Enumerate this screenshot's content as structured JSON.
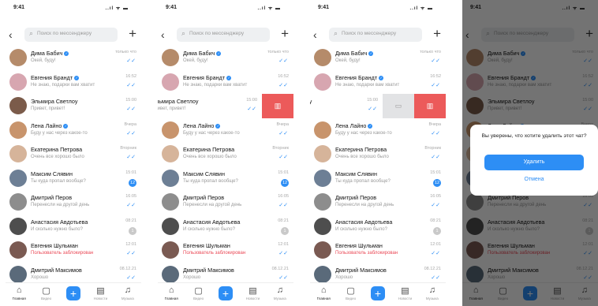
{
  "status": {
    "time": "9:41",
    "system": "..ıl ᯤ ▬"
  },
  "search": {
    "placeholder": "Поиск по мессенджеру"
  },
  "chats": [
    {
      "name": "Дима Бабич",
      "verified": true,
      "preview": "Окей, буду!",
      "time": "только что",
      "status": "read",
      "color": "#b58b6a"
    },
    {
      "name": "Евгения Брандт",
      "verified": true,
      "preview": "Не знаю, подарки вам хватит",
      "time": "16:52",
      "status": "read",
      "color": "#d7a6b0"
    },
    {
      "name": "Эльмира Светлоу",
      "verified": false,
      "preview": "Привет, привет!",
      "time": "15:00",
      "status": "read",
      "color": "#7b5b4a"
    },
    {
      "name": "Лена Лайно",
      "verified": true,
      "preview": "Буду у нас через какое-то",
      "time": "Вчера",
      "status": "read",
      "color": "#c8946c"
    },
    {
      "name": "Екатерина Петрова",
      "verified": false,
      "preview": "Очень все хорошо было",
      "time": "Вторник",
      "status": "read",
      "color": "#d6b49a"
    },
    {
      "name": "Максим Слявин",
      "verified": false,
      "preview": "Ты куда пропал вообще?",
      "time": "15:01",
      "status": "badge",
      "badge": "12",
      "color": "#6d7f95"
    },
    {
      "name": "Дмитрий Перов",
      "verified": false,
      "preview": "Перенесли на другой день",
      "time": "16:05",
      "status": "read",
      "color": "#8d8d8d"
    },
    {
      "name": "Анастасия Авдотьева",
      "verified": false,
      "preview": "И сколько нужно было?",
      "time": "08:21",
      "status": "grey",
      "badge": "1",
      "color": "#4e4e4e"
    },
    {
      "name": "Евгения Шульман",
      "verified": false,
      "preview": "Пользователь заблокирован",
      "time": "12:01",
      "status": "read",
      "warn": true,
      "color": "#7a5a52"
    },
    {
      "name": "Дмитрий Максимов",
      "verified": false,
      "preview": "Хорошо",
      "time": "08.12.21",
      "status": "read",
      "color": "#5a6a7a"
    }
  ],
  "swipe_row": {
    "name_cut_1": "Эльмира Светлоу",
    "preview_cut_1": "Привет, привет!",
    "name_cut_2": "ьмира Светлоу",
    "preview_cut_2": "ивет, привет!"
  },
  "actions": {
    "archive_icon": "archive-icon",
    "delete_icon": "trash-icon"
  },
  "tabs": [
    {
      "label": "Главная",
      "icon": "home-icon",
      "glyph": "⌂"
    },
    {
      "label": "Видео",
      "icon": "video-icon",
      "glyph": "▢"
    },
    {
      "label": "",
      "icon": "plus-icon",
      "glyph": "+"
    },
    {
      "label": "Новости",
      "icon": "news-icon",
      "glyph": "▤"
    },
    {
      "label": "Музыка",
      "icon": "music-icon",
      "glyph": "♫"
    }
  ],
  "dialog": {
    "question": "Вы уверены, что хотите удалить этот чат?",
    "confirm": "Удалить",
    "cancel": "Отмена"
  },
  "colors": {
    "accent": "#2d8ef5",
    "danger": "#ec5a5a",
    "overlay": "rgba(0,0,0,0.55)"
  }
}
